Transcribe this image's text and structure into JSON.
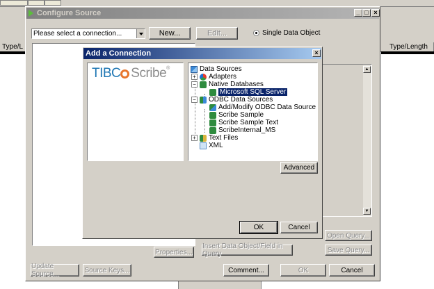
{
  "background": {
    "left_header": "Type/L",
    "right_header": "Type/Length"
  },
  "configure_source": {
    "title": "Configure Source",
    "connection_select": {
      "value": "Please select a connection..."
    },
    "new_button": "New...",
    "edit_button": "Edit...",
    "radio_label": "Single Data Object",
    "properties_button": "Properties...",
    "insert_button": "Insert Data Object/Field in Query",
    "open_query_button": "Open Query...",
    "save_query_button": "Save Query...",
    "update_source_button": "Update Source...",
    "source_keys_button": "Source Keys...",
    "comment_button": "Comment...",
    "ok_button": "OK",
    "cancel_button": "Cancel"
  },
  "add_connection": {
    "title": "Add a Connection",
    "logo": {
      "brand": "TIBC",
      "product": "Scribe"
    },
    "tree": [
      {
        "label": "Data Sources",
        "level": 0
      },
      {
        "label": "Adapters",
        "level": 1
      },
      {
        "label": "Native Databases",
        "level": 1
      },
      {
        "label": "Microsoft SQL Server",
        "level": 2,
        "selected": true
      },
      {
        "label": "ODBC Data Sources",
        "level": 1
      },
      {
        "label": "Add/Modify ODBC Data Source",
        "level": 2
      },
      {
        "label": "Scribe Sample",
        "level": 2
      },
      {
        "label": "Scribe Sample Text",
        "level": 2
      },
      {
        "label": "ScribeInternal_MS",
        "level": 2
      },
      {
        "label": "Text Files",
        "level": 1
      },
      {
        "label": "XML",
        "level": 1
      }
    ],
    "advanced_button": "Advanced",
    "ok_button": "OK",
    "cancel_button": "Cancel"
  },
  "colors": {
    "active_title": "#0a246a",
    "inactive_title": "#808080",
    "logo_orange": "#e8762d",
    "logo_blue": "#1f77b4"
  }
}
